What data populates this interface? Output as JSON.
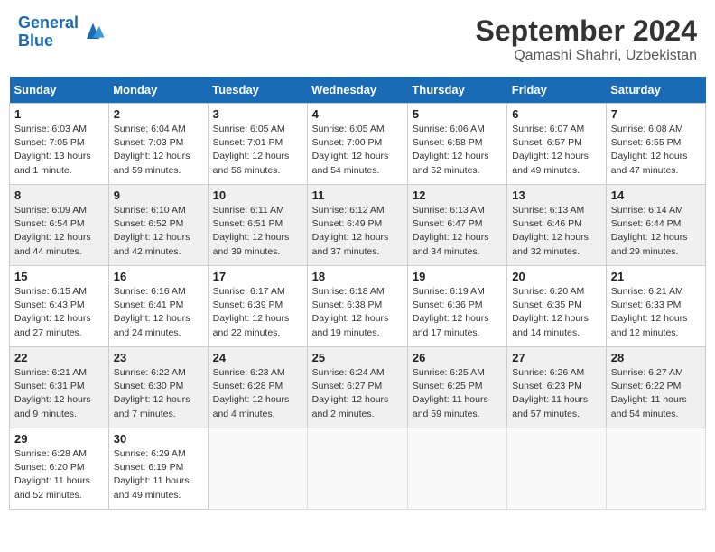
{
  "header": {
    "logo_line1": "General",
    "logo_line2": "Blue",
    "month": "September 2024",
    "location": "Qamashi Shahri, Uzbekistan"
  },
  "columns": [
    "Sunday",
    "Monday",
    "Tuesday",
    "Wednesday",
    "Thursday",
    "Friday",
    "Saturday"
  ],
  "weeks": [
    [
      {
        "day": "1",
        "sunrise": "Sunrise: 6:03 AM",
        "sunset": "Sunset: 7:05 PM",
        "daylight": "Daylight: 13 hours and 1 minute."
      },
      {
        "day": "2",
        "sunrise": "Sunrise: 6:04 AM",
        "sunset": "Sunset: 7:03 PM",
        "daylight": "Daylight: 12 hours and 59 minutes."
      },
      {
        "day": "3",
        "sunrise": "Sunrise: 6:05 AM",
        "sunset": "Sunset: 7:01 PM",
        "daylight": "Daylight: 12 hours and 56 minutes."
      },
      {
        "day": "4",
        "sunrise": "Sunrise: 6:05 AM",
        "sunset": "Sunset: 7:00 PM",
        "daylight": "Daylight: 12 hours and 54 minutes."
      },
      {
        "day": "5",
        "sunrise": "Sunrise: 6:06 AM",
        "sunset": "Sunset: 6:58 PM",
        "daylight": "Daylight: 12 hours and 52 minutes."
      },
      {
        "day": "6",
        "sunrise": "Sunrise: 6:07 AM",
        "sunset": "Sunset: 6:57 PM",
        "daylight": "Daylight: 12 hours and 49 minutes."
      },
      {
        "day": "7",
        "sunrise": "Sunrise: 6:08 AM",
        "sunset": "Sunset: 6:55 PM",
        "daylight": "Daylight: 12 hours and 47 minutes."
      }
    ],
    [
      {
        "day": "8",
        "sunrise": "Sunrise: 6:09 AM",
        "sunset": "Sunset: 6:54 PM",
        "daylight": "Daylight: 12 hours and 44 minutes."
      },
      {
        "day": "9",
        "sunrise": "Sunrise: 6:10 AM",
        "sunset": "Sunset: 6:52 PM",
        "daylight": "Daylight: 12 hours and 42 minutes."
      },
      {
        "day": "10",
        "sunrise": "Sunrise: 6:11 AM",
        "sunset": "Sunset: 6:51 PM",
        "daylight": "Daylight: 12 hours and 39 minutes."
      },
      {
        "day": "11",
        "sunrise": "Sunrise: 6:12 AM",
        "sunset": "Sunset: 6:49 PM",
        "daylight": "Daylight: 12 hours and 37 minutes."
      },
      {
        "day": "12",
        "sunrise": "Sunrise: 6:13 AM",
        "sunset": "Sunset: 6:47 PM",
        "daylight": "Daylight: 12 hours and 34 minutes."
      },
      {
        "day": "13",
        "sunrise": "Sunrise: 6:13 AM",
        "sunset": "Sunset: 6:46 PM",
        "daylight": "Daylight: 12 hours and 32 minutes."
      },
      {
        "day": "14",
        "sunrise": "Sunrise: 6:14 AM",
        "sunset": "Sunset: 6:44 PM",
        "daylight": "Daylight: 12 hours and 29 minutes."
      }
    ],
    [
      {
        "day": "15",
        "sunrise": "Sunrise: 6:15 AM",
        "sunset": "Sunset: 6:43 PM",
        "daylight": "Daylight: 12 hours and 27 minutes."
      },
      {
        "day": "16",
        "sunrise": "Sunrise: 6:16 AM",
        "sunset": "Sunset: 6:41 PM",
        "daylight": "Daylight: 12 hours and 24 minutes."
      },
      {
        "day": "17",
        "sunrise": "Sunrise: 6:17 AM",
        "sunset": "Sunset: 6:39 PM",
        "daylight": "Daylight: 12 hours and 22 minutes."
      },
      {
        "day": "18",
        "sunrise": "Sunrise: 6:18 AM",
        "sunset": "Sunset: 6:38 PM",
        "daylight": "Daylight: 12 hours and 19 minutes."
      },
      {
        "day": "19",
        "sunrise": "Sunrise: 6:19 AM",
        "sunset": "Sunset: 6:36 PM",
        "daylight": "Daylight: 12 hours and 17 minutes."
      },
      {
        "day": "20",
        "sunrise": "Sunrise: 6:20 AM",
        "sunset": "Sunset: 6:35 PM",
        "daylight": "Daylight: 12 hours and 14 minutes."
      },
      {
        "day": "21",
        "sunrise": "Sunrise: 6:21 AM",
        "sunset": "Sunset: 6:33 PM",
        "daylight": "Daylight: 12 hours and 12 minutes."
      }
    ],
    [
      {
        "day": "22",
        "sunrise": "Sunrise: 6:21 AM",
        "sunset": "Sunset: 6:31 PM",
        "daylight": "Daylight: 12 hours and 9 minutes."
      },
      {
        "day": "23",
        "sunrise": "Sunrise: 6:22 AM",
        "sunset": "Sunset: 6:30 PM",
        "daylight": "Daylight: 12 hours and 7 minutes."
      },
      {
        "day": "24",
        "sunrise": "Sunrise: 6:23 AM",
        "sunset": "Sunset: 6:28 PM",
        "daylight": "Daylight: 12 hours and 4 minutes."
      },
      {
        "day": "25",
        "sunrise": "Sunrise: 6:24 AM",
        "sunset": "Sunset: 6:27 PM",
        "daylight": "Daylight: 12 hours and 2 minutes."
      },
      {
        "day": "26",
        "sunrise": "Sunrise: 6:25 AM",
        "sunset": "Sunset: 6:25 PM",
        "daylight": "Daylight: 11 hours and 59 minutes."
      },
      {
        "day": "27",
        "sunrise": "Sunrise: 6:26 AM",
        "sunset": "Sunset: 6:23 PM",
        "daylight": "Daylight: 11 hours and 57 minutes."
      },
      {
        "day": "28",
        "sunrise": "Sunrise: 6:27 AM",
        "sunset": "Sunset: 6:22 PM",
        "daylight": "Daylight: 11 hours and 54 minutes."
      }
    ],
    [
      {
        "day": "29",
        "sunrise": "Sunrise: 6:28 AM",
        "sunset": "Sunset: 6:20 PM",
        "daylight": "Daylight: 11 hours and 52 minutes."
      },
      {
        "day": "30",
        "sunrise": "Sunrise: 6:29 AM",
        "sunset": "Sunset: 6:19 PM",
        "daylight": "Daylight: 11 hours and 49 minutes."
      },
      null,
      null,
      null,
      null,
      null
    ]
  ]
}
